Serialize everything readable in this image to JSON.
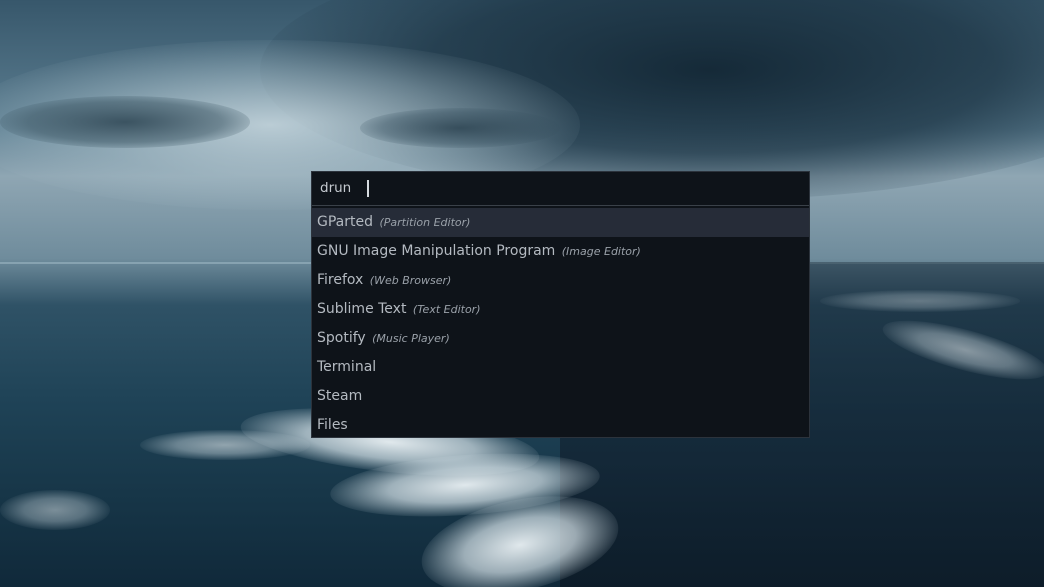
{
  "launcher": {
    "prompt": "drun",
    "input_value": "",
    "results": [
      {
        "name": "GParted",
        "description": "(Partition Editor)",
        "selected": true
      },
      {
        "name": "GNU Image Manipulation Program",
        "description": "(Image Editor)",
        "selected": false
      },
      {
        "name": "Firefox",
        "description": "(Web Browser)",
        "selected": false
      },
      {
        "name": "Sublime Text",
        "description": "(Text Editor)",
        "selected": false
      },
      {
        "name": "Spotify",
        "description": "(Music Player)",
        "selected": false
      },
      {
        "name": "Terminal",
        "description": "",
        "selected": false
      },
      {
        "name": "Steam",
        "description": "",
        "selected": false
      },
      {
        "name": "Files",
        "description": "",
        "selected": false
      }
    ]
  },
  "colors": {
    "launcher_background": "#0e1319",
    "selected_row": "#262c38",
    "text": "#b4bac1"
  }
}
